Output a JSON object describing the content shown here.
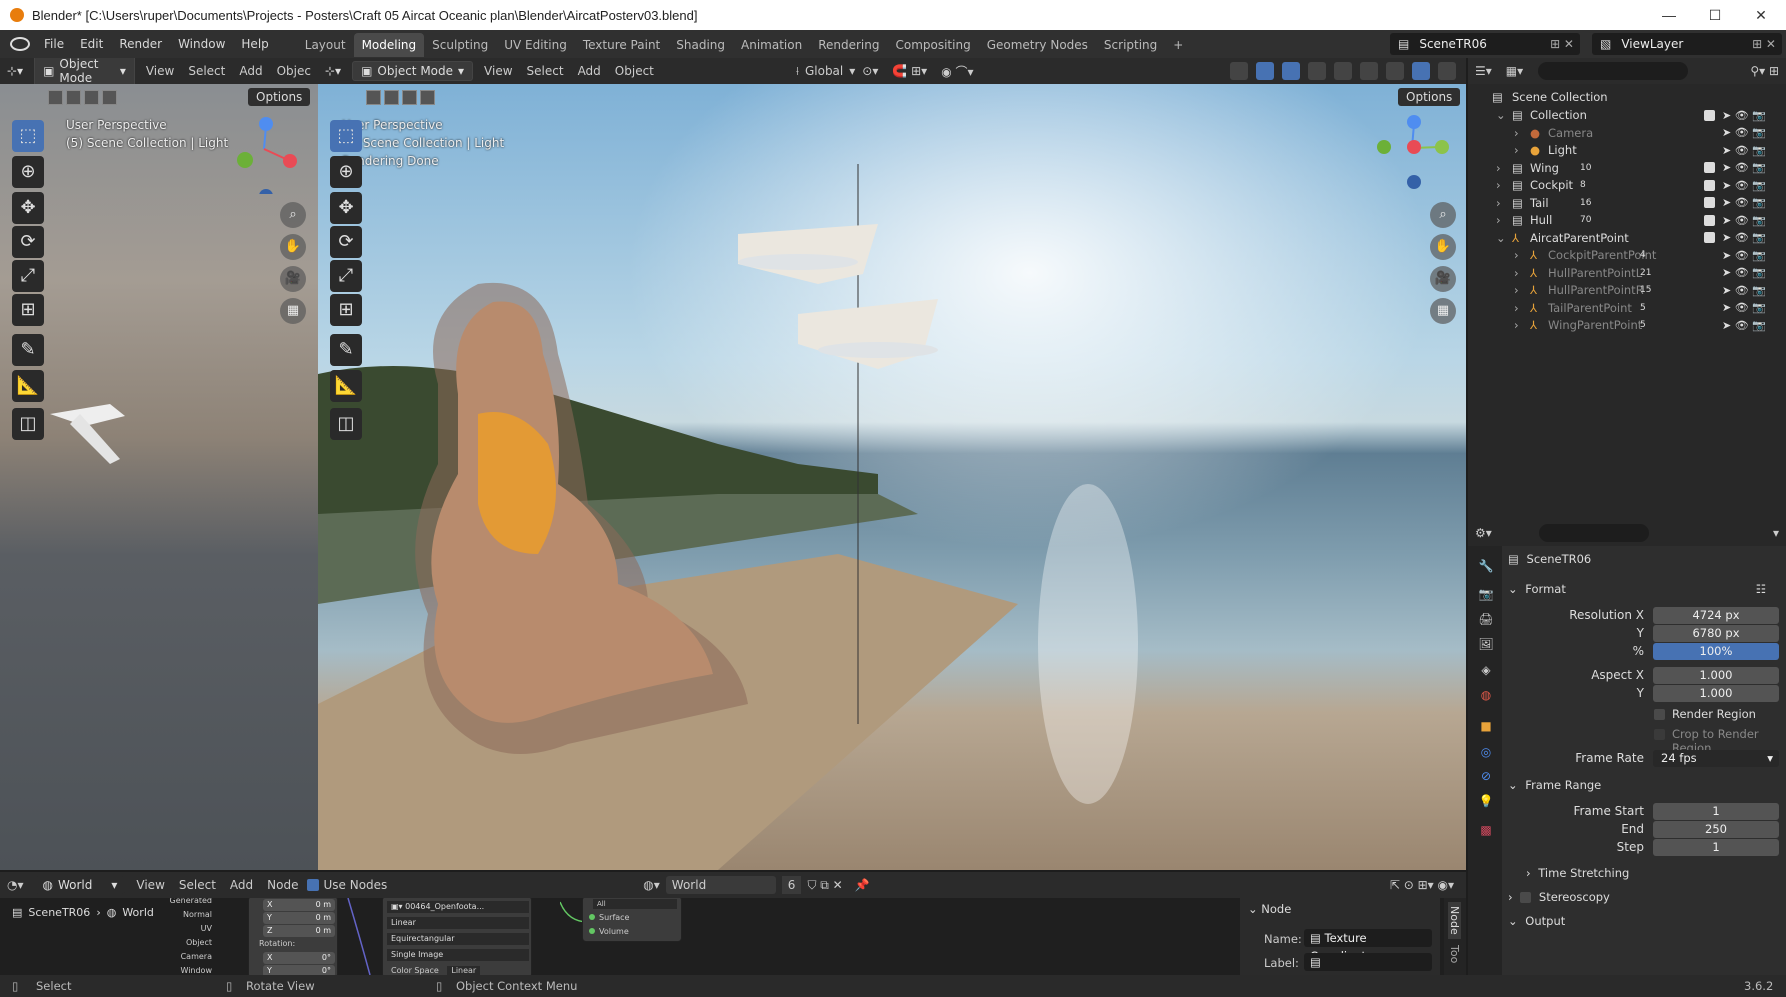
{
  "window": {
    "title": "Blender* [C:\\Users\\ruper\\Documents\\Projects - Posters\\Craft 05 Aircat Oceanic plan\\Blender\\AircatPosterv03.blend]",
    "minimize": "—",
    "maximize": "☐",
    "close": "✕"
  },
  "menu": [
    "File",
    "Edit",
    "Render",
    "Window",
    "Help"
  ],
  "workspaces": [
    "Layout",
    "Modeling",
    "Sculpting",
    "UV Editing",
    "Texture Paint",
    "Shading",
    "Animation",
    "Rendering",
    "Compositing",
    "Geometry Nodes",
    "Scripting",
    "+"
  ],
  "active_workspace": "Modeling",
  "scene": "SceneTR06",
  "view_layer": "ViewLayer",
  "left_viewport": {
    "mode": "Object Mode",
    "menus": [
      "View",
      "Select",
      "Add",
      "Objec"
    ],
    "options": "Options",
    "line1": "User Perspective",
    "line2": "(5) Scene Collection | Light"
  },
  "main_viewport": {
    "mode": "Object Mode",
    "menus": [
      "View",
      "Select",
      "Add",
      "Object"
    ],
    "transform": "Global",
    "options": "Options",
    "line1": "User Perspective",
    "line2": "(5) Scene Collection | Light",
    "line3": "Rendering Done"
  },
  "outliner": {
    "root": "Scene Collection",
    "rows": [
      {
        "name": "Collection",
        "indent": 1,
        "expanded": true,
        "dim": false,
        "badge": ""
      },
      {
        "name": "Camera",
        "indent": 2,
        "dim": true,
        "badge": ""
      },
      {
        "name": "Light",
        "indent": 2,
        "dim": false,
        "badge": ""
      },
      {
        "name": "Wing",
        "indent": 1,
        "dim": false,
        "badge": "10"
      },
      {
        "name": "Cockpit",
        "indent": 1,
        "dim": false,
        "badge": "8"
      },
      {
        "name": "Tail",
        "indent": 1,
        "dim": false,
        "badge": "16"
      },
      {
        "name": "Hull",
        "indent": 1,
        "dim": false,
        "badge": "70"
      },
      {
        "name": "AircatParentPoint",
        "indent": 1,
        "expanded": true,
        "dim": false,
        "badge": ""
      },
      {
        "name": "CockpitParentPoint",
        "indent": 2,
        "dim": true,
        "badge": "4"
      },
      {
        "name": "HullParentPointL",
        "indent": 2,
        "dim": true,
        "badge": "21"
      },
      {
        "name": "HullParentPointR",
        "indent": 2,
        "dim": true,
        "badge": "15"
      },
      {
        "name": "TailParentPoint",
        "indent": 2,
        "dim": true,
        "badge": "5"
      },
      {
        "name": "WingParentPoint",
        "indent": 2,
        "dim": true,
        "badge": "5"
      }
    ]
  },
  "properties": {
    "scene_name": "SceneTR06",
    "format": {
      "title": "Format",
      "res_x_label": "Resolution X",
      "res_x": "4724 px",
      "res_y_label": "Y",
      "res_y": "6780 px",
      "pct_label": "%",
      "pct": "100%",
      "aspect_x_label": "Aspect X",
      "aspect_x": "1.000",
      "aspect_y_label": "Y",
      "aspect_y": "1.000",
      "render_region": "Render Region",
      "crop": "Crop to Render Region",
      "frame_rate_label": "Frame Rate",
      "frame_rate": "24 fps"
    },
    "frame_range": {
      "title": "Frame Range",
      "start_label": "Frame Start",
      "start": "1",
      "end_label": "End",
      "end": "250",
      "step_label": "Step",
      "step": "1"
    },
    "time_stretching": "Time Stretching",
    "stereoscopy": "Stereoscopy",
    "output": "Output"
  },
  "node_editor": {
    "type": "World",
    "menus": [
      "View",
      "Select",
      "Add",
      "Node"
    ],
    "use_nodes": "Use Nodes",
    "world_name": "World",
    "users": "6",
    "breadcrumb_scene": "SceneTR06",
    "breadcrumb_world": "World",
    "tex_coord_outputs": [
      "Generated",
      "Normal",
      "UV",
      "Object",
      "Camera",
      "Window"
    ],
    "mapping_fields": [
      {
        "label": "X",
        "value": "0 m"
      },
      {
        "label": "Y",
        "value": "0 m"
      },
      {
        "label": "Z",
        "value": "0 m"
      }
    ],
    "rotation_label": "Rotation:",
    "rotation_fields": [
      {
        "label": "X",
        "value": "0°"
      },
      {
        "label": "Y",
        "value": "0°"
      }
    ],
    "image_name": "00464_Openfoota...",
    "image_opts": [
      "Linear",
      "Equirectangular",
      "Single Image"
    ],
    "color_space_label": "Color Space",
    "color_space": "Linear",
    "output_target": "All",
    "output_sockets": [
      "Surface",
      "Volume"
    ],
    "side_title": "Node",
    "side_name_label": "Name:",
    "side_name": "Texture Coordinate",
    "side_label_label": "Label:",
    "side_tabs": [
      "Node",
      "Too"
    ]
  },
  "status": {
    "select": "Select",
    "rotate": "Rotate View",
    "context": "Object Context Menu",
    "version": "3.6.2"
  },
  "colors": {
    "accent": "#4772b3",
    "bg": "#1d1d1d",
    "panel": "#303030"
  }
}
